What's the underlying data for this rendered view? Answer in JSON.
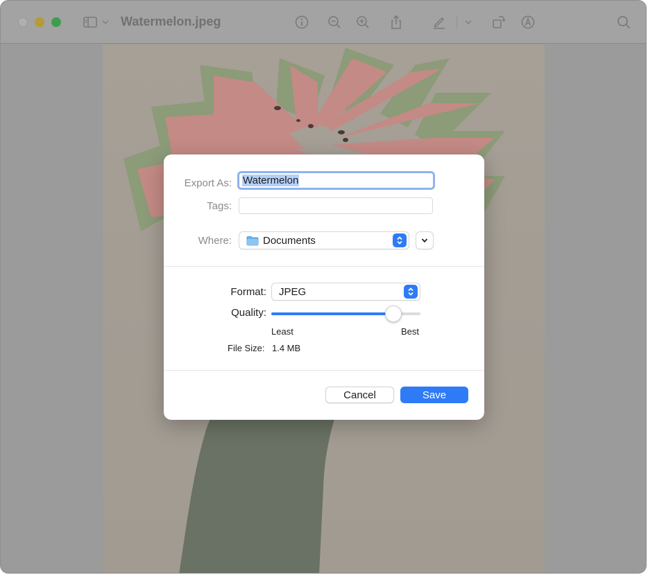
{
  "window": {
    "title": "Watermelon.jpeg",
    "toolbar": {
      "icons": [
        "sidebar-icon",
        "chevron-down-icon",
        "info-icon",
        "zoom-out-icon",
        "zoom-in-icon",
        "share-icon",
        "markup-pen-icon",
        "chevron-down-icon",
        "rotate-icon",
        "annotate-icon",
        "search-icon"
      ]
    }
  },
  "dialog": {
    "export_as_label": "Export As:",
    "export_as_value": "Watermelon",
    "tags_label": "Tags:",
    "tags_value": "",
    "where_label": "Where:",
    "where_value": "Documents",
    "format_label": "Format:",
    "format_value": "JPEG",
    "quality_label": "Quality:",
    "quality_level": 0.82,
    "quality_min_label": "Least",
    "quality_max_label": "Best",
    "file_size_label": "File Size:",
    "file_size_value": "1.4 MB",
    "cancel_label": "Cancel",
    "save_label": "Save"
  },
  "colors": {
    "accent": "#2f7bf5",
    "focus_ring": "#8fb2ec",
    "selection": "#b3d0f7"
  }
}
